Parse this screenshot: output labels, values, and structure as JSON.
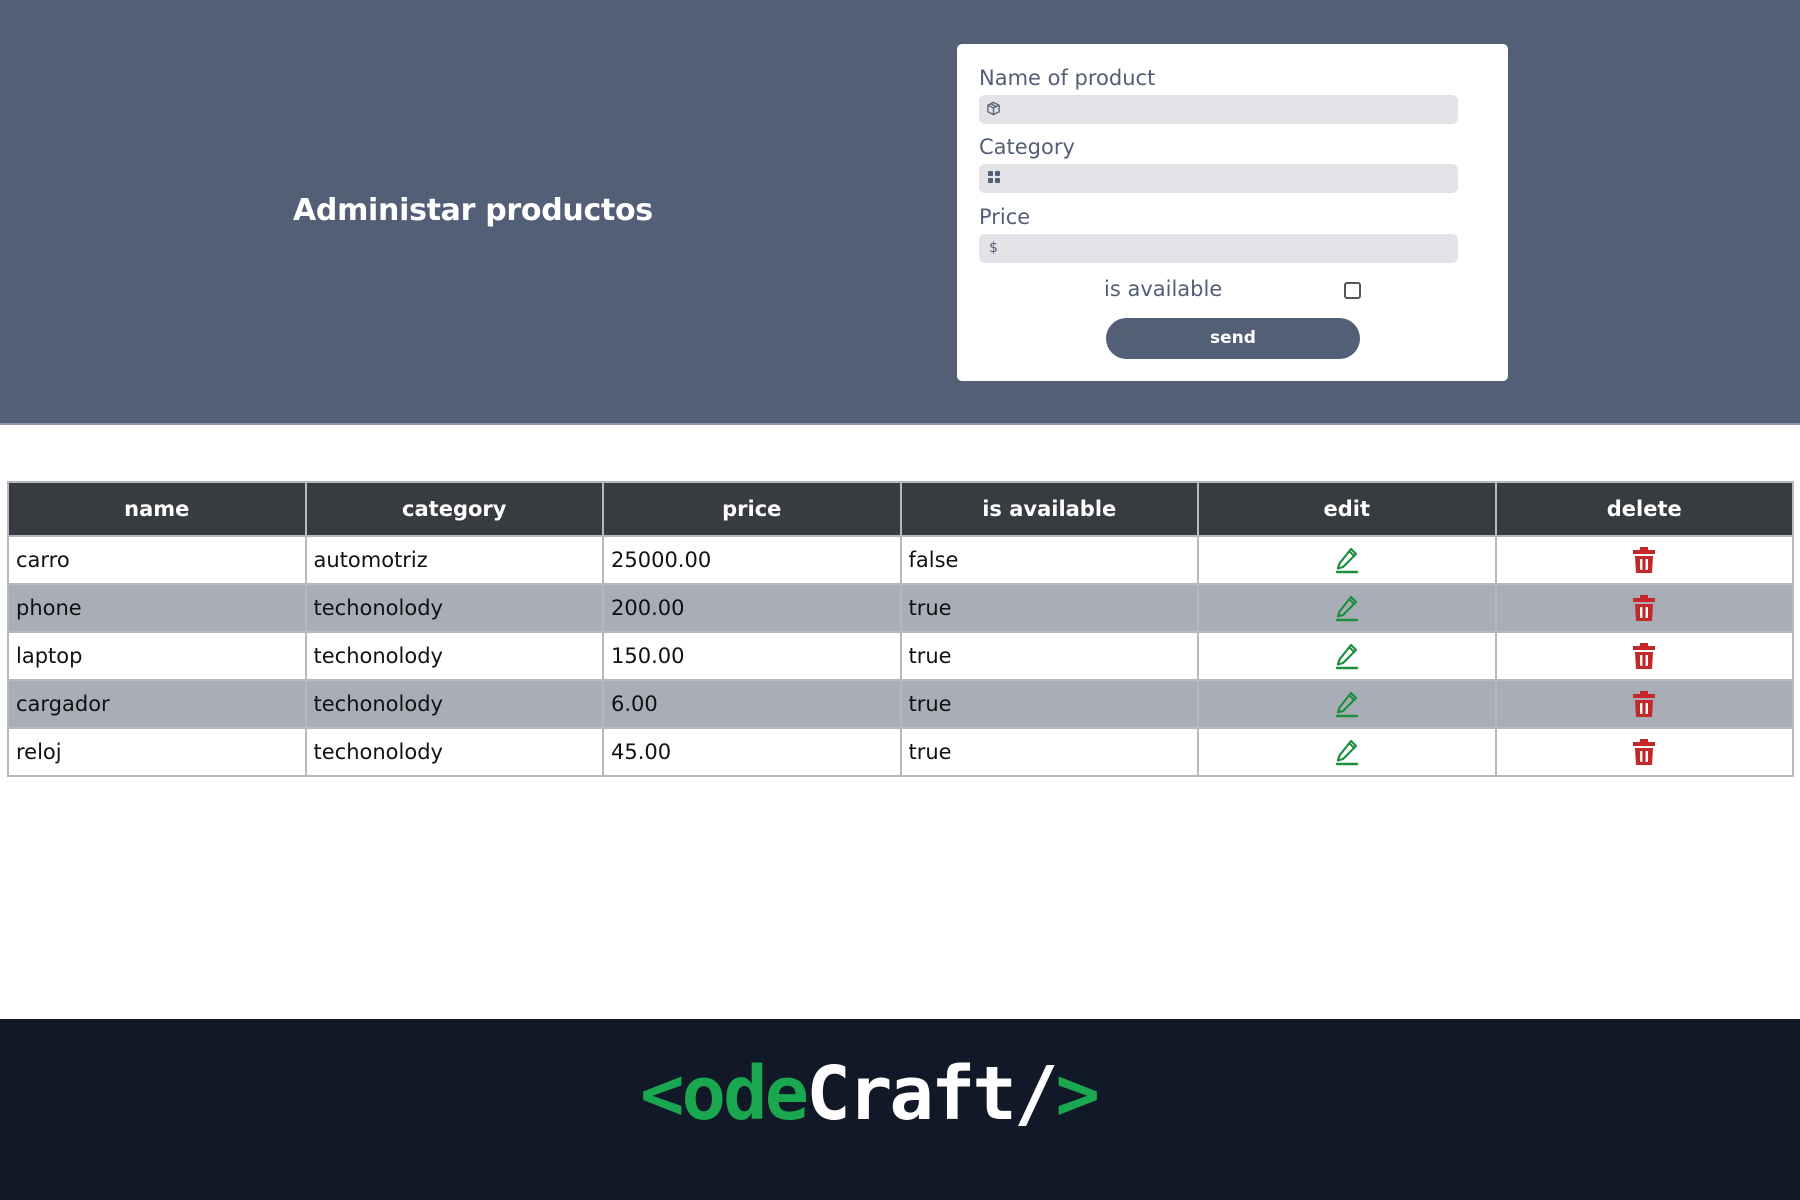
{
  "header": {
    "title": "Administar productos"
  },
  "form": {
    "name_label": "Name of product",
    "name_icon": "cube-icon",
    "name_value": "",
    "category_label": "Category",
    "category_icon": "grid-icon",
    "category_value": "",
    "price_label": "Price",
    "price_icon": "dollar-icon",
    "price_value": "",
    "available_label": "is available",
    "available_checked": false,
    "send_label": "send"
  },
  "table": {
    "columns": [
      "name",
      "category",
      "price",
      "is available",
      "edit",
      "delete"
    ],
    "rows": [
      {
        "name": "carro",
        "category": "automotriz",
        "price": "25000.00",
        "available": "false"
      },
      {
        "name": "phone",
        "category": "techonolody",
        "price": "200.00",
        "available": "true"
      },
      {
        "name": "laptop",
        "category": "techonolody",
        "price": "150.00",
        "available": "true"
      },
      {
        "name": "cargador",
        "category": "techonolody",
        "price": "6.00",
        "available": "true"
      },
      {
        "name": "reloj",
        "category": "techonolody",
        "price": "45.00",
        "available": "true"
      }
    ],
    "edit_icon": "pencil-icon",
    "delete_icon": "trash-icon"
  },
  "footer": {
    "logo_green_1": "<ode",
    "logo_white": "Craft/",
    "logo_green_2": ">"
  },
  "colors": {
    "header_bg": "#535f77",
    "table_header_bg": "#383b3f",
    "row_alt_bg": "#a8adb8",
    "edit_green": "#1e8f3e",
    "delete_red": "#c62828",
    "footer_bg": "#111827",
    "logo_green": "#19a84f"
  }
}
